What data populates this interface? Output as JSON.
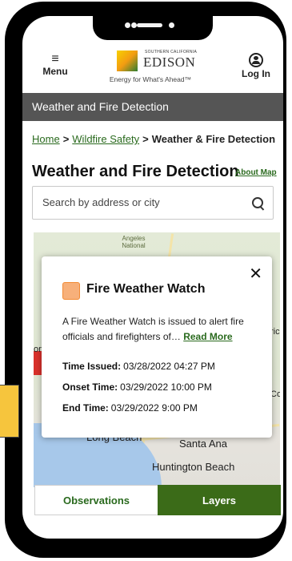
{
  "header": {
    "menu_label": "Menu",
    "login_label": "Log In",
    "logo_small": "SOUTHERN CALIFORNIA",
    "logo_name": "EDISON",
    "logo_tagline": "Energy for What's Ahead™"
  },
  "section_bar": "Weather and Fire Detection",
  "breadcrumb": {
    "home": "Home",
    "wildfire": "Wildfire Safety",
    "current": "Weather & Fire Detection",
    "separator": ">"
  },
  "page_title": "Weather and Fire Detection",
  "about_map_link": "About Map",
  "search": {
    "placeholder": "Search by address or city"
  },
  "map": {
    "labels": [
      "Angeles National",
      "Long Beach",
      "Santa Ana",
      "Huntington Beach"
    ],
    "edge_labels": [
      "ric",
      "on",
      "Co"
    ]
  },
  "popup": {
    "title": "Fire Weather Watch",
    "description": "A Fire Weather Watch is issued to alert fire officials and firefighters of…",
    "read_more": "Read More",
    "time_issued_label": "Time Issued:",
    "time_issued_value": "03/28/2022 04:27 PM",
    "onset_label": "Onset Time:",
    "onset_value": "03/29/2022 10:00 PM",
    "end_label": "End Time:",
    "end_value": "03/29/2022 9:00 PM",
    "swatch_color": "#f7b07a",
    "close_icon": "close-icon"
  },
  "tabs": {
    "observations": "Observations",
    "layers": "Layers"
  },
  "colors": {
    "accent_green": "#3b6b18",
    "link_green": "#2a6a1e",
    "bar_grey": "#555555"
  }
}
